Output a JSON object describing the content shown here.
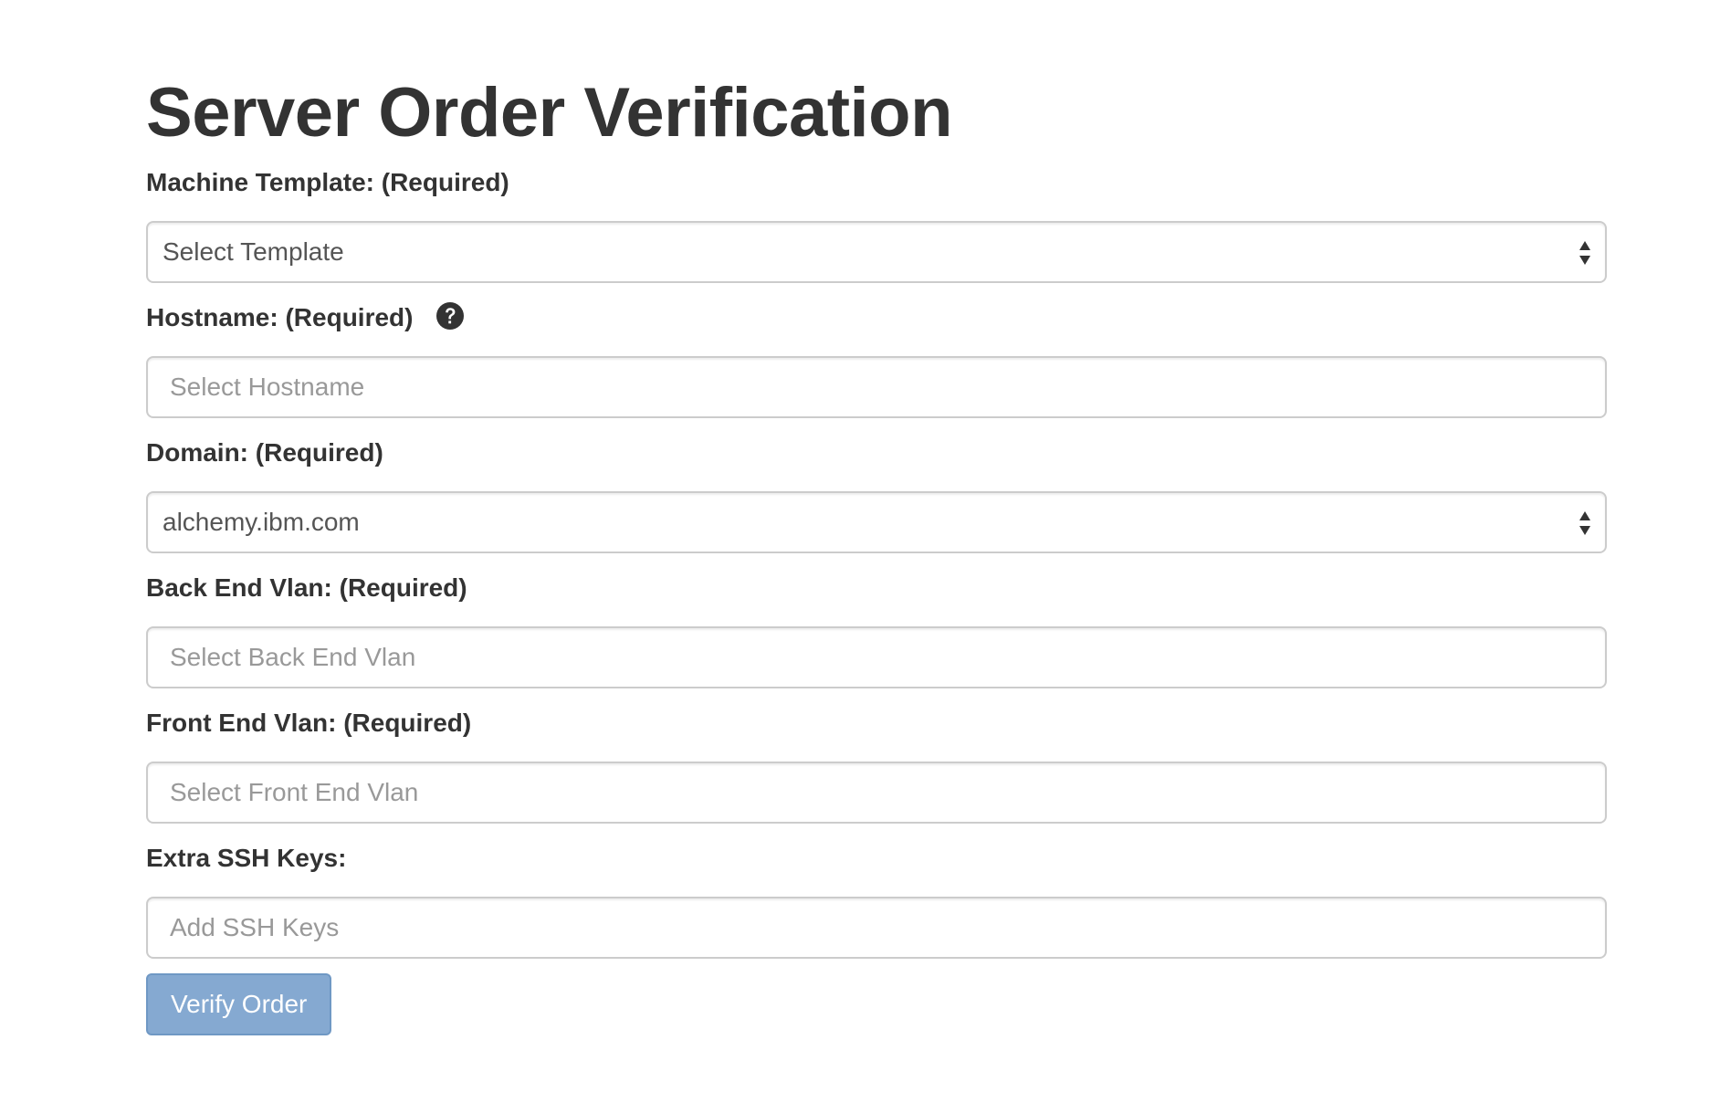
{
  "page": {
    "title": "Server Order Verification"
  },
  "form": {
    "machine_template": {
      "label": "Machine Template: (Required)",
      "selected_value": "Select Template"
    },
    "hostname": {
      "label": "Hostname: (Required)",
      "placeholder": "Select Hostname",
      "help_icon": "question-circle-icon"
    },
    "domain": {
      "label": "Domain: (Required)",
      "selected_value": "alchemy.ibm.com"
    },
    "back_end_vlan": {
      "label": "Back End Vlan: (Required)",
      "placeholder": "Select Back End Vlan"
    },
    "front_end_vlan": {
      "label": "Front End Vlan: (Required)",
      "placeholder": "Select Front End Vlan"
    },
    "extra_ssh_keys": {
      "label": "Extra SSH Keys:",
      "placeholder": "Add SSH Keys"
    },
    "submit_label": "Verify Order"
  },
  "colors": {
    "text": "#333333",
    "input_border": "#cccccc",
    "placeholder": "#999999",
    "button_bg": "#85a9d1",
    "button_text": "#ffffff"
  }
}
